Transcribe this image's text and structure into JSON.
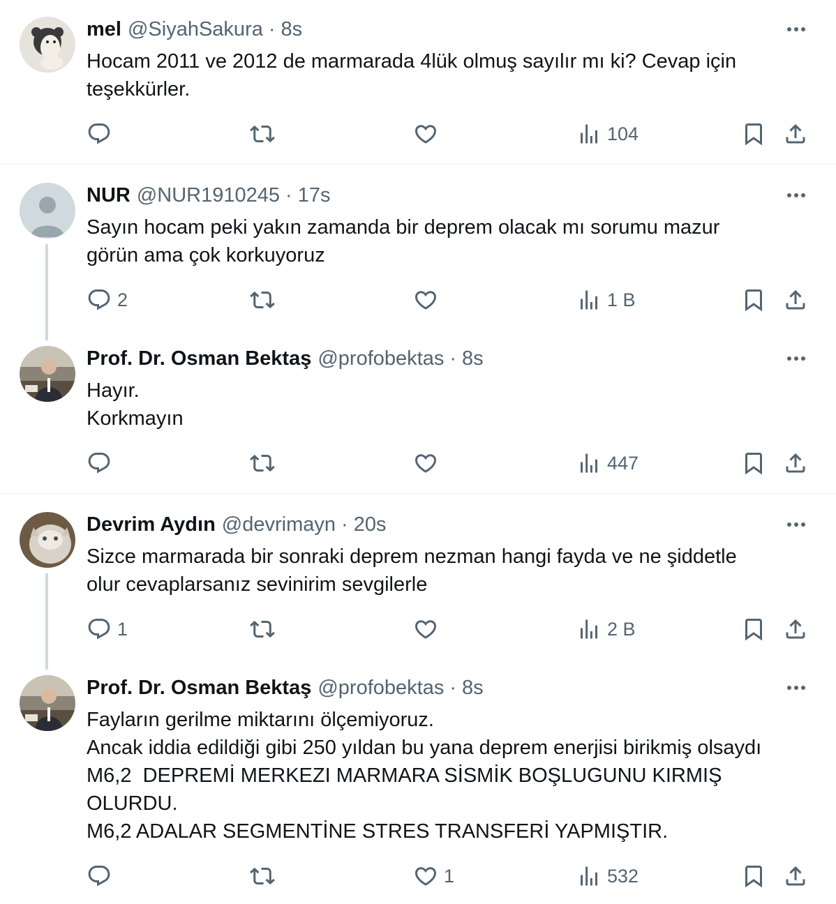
{
  "tweets": [
    {
      "name": "mel",
      "handle": "@SiyahSakura",
      "time": "8s",
      "lines": [
        "Hocam 2011 ve 2012 de marmarada 4lük olmuş sayılır mı ki? Cevap için",
        "teşekkürler."
      ],
      "replies": "",
      "likes": "",
      "views": "104"
    },
    {
      "name": "NUR",
      "handle": "@NUR1910245",
      "time": "17s",
      "lines": [
        "Sayın hocam peki yakın zamanda bir deprem olacak mı sorumu mazur",
        "görün ama çok korkuyoruz"
      ],
      "replies": "2",
      "likes": "",
      "views": "1 B"
    },
    {
      "name": "Prof. Dr. Osman Bektaş",
      "handle": "@profobektas",
      "time": "8s",
      "lines": [
        "Hayır.",
        "Korkmayın"
      ],
      "replies": "",
      "likes": "",
      "views": "447"
    },
    {
      "name": "Devrim Aydın",
      "handle": "@devrimayn",
      "time": "20s",
      "lines": [
        "Sizce marmarada bir sonraki deprem nezman hangi fayda ve ne şiddetle",
        "olur cevaplarsanız sevinirim sevgilerle"
      ],
      "replies": "1",
      "likes": "",
      "views": "2 B"
    },
    {
      "name": "Prof. Dr. Osman Bektaş",
      "handle": "@profobektas",
      "time": "8s",
      "lines": [
        "Fayların gerilme miktarını ölçemiyoruz.",
        "Ancak iddia edildiği gibi 250 yıldan bu yana deprem enerjisi birikmiş olsaydı",
        "M6,2  DEPREMİ MERKEZI MARMARA SİSMİK BOŞLUGUNU KIRMIŞ",
        "OLURDU.",
        "M6,2 ADALAR SEGMENTİNE STRES TRANSFERİ YAPMIŞTIR."
      ],
      "replies": "",
      "likes": "1",
      "views": "532"
    }
  ],
  "colors": {
    "text": "#0f1419",
    "secondary": "#536471",
    "divider": "#eff3f4",
    "thread_line": "#cfd9de"
  },
  "icons": {
    "more": "more-horizontal-icon",
    "reply": "reply-bubble-icon",
    "retweet": "retweet-icon",
    "like": "heart-icon",
    "views": "bar-chart-icon",
    "bookmark": "bookmark-icon",
    "share": "share-upload-icon"
  }
}
